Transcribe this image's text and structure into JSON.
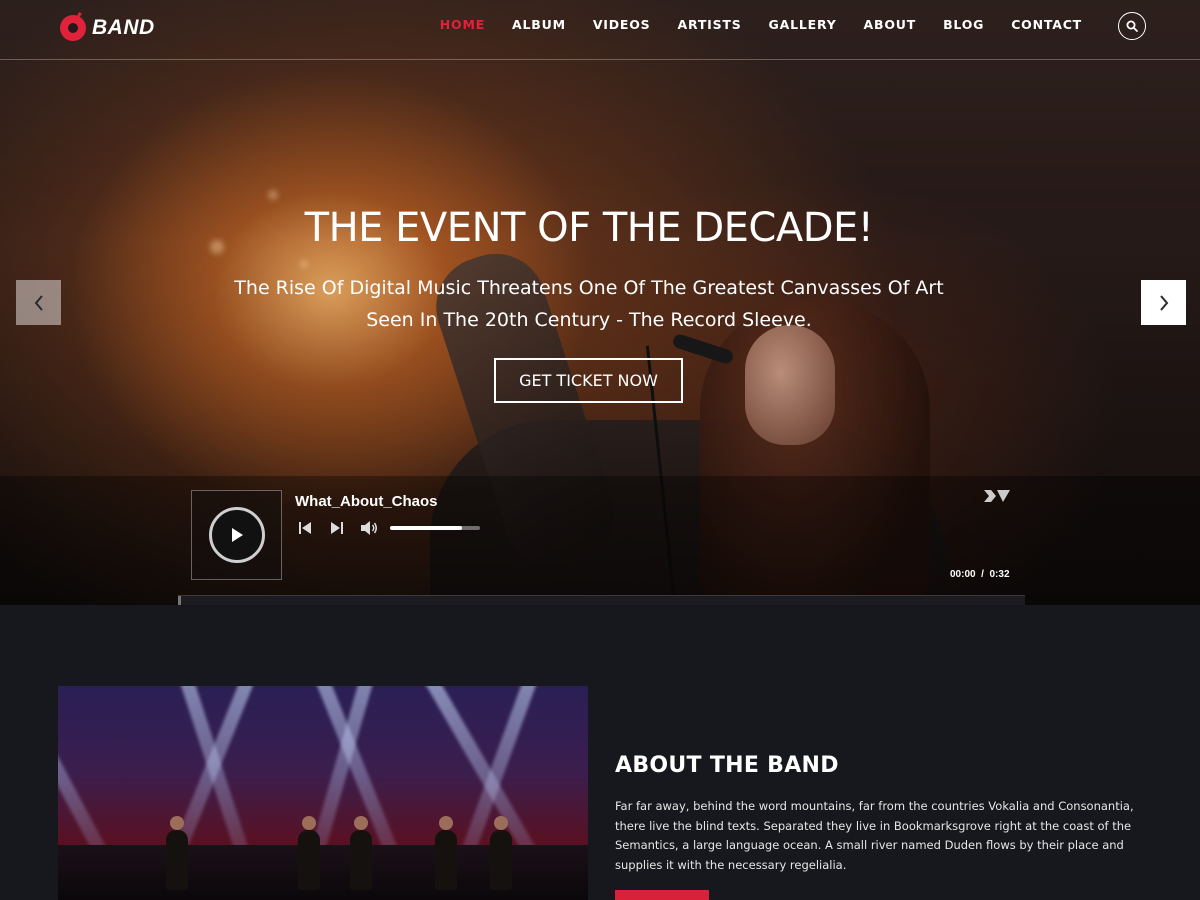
{
  "brand": {
    "name": "BAND",
    "accent": "#e0223b"
  },
  "nav": {
    "items": [
      "HOME",
      "ALBUM",
      "VIDEOS",
      "ARTISTS",
      "GALLERY",
      "ABOUT",
      "BLOG",
      "CONTACT"
    ],
    "active": "HOME",
    "search_icon": "search-icon"
  },
  "hero": {
    "title": "THE EVENT OF THE DECADE!",
    "subtitle_line1": "The Rise Of Digital Music Threatens One Of The Greatest Canvasses Of Art",
    "subtitle_line2": "Seen In The 20th Century - The Record Sleeve.",
    "cta_label": "GET TICKET NOW",
    "prev_icon": "chevron-left-icon",
    "next_icon": "chevron-right-icon"
  },
  "player": {
    "track": "What_About_Chaos",
    "current_time": "00:00",
    "separator": "/",
    "duration": "0:32",
    "volume": 0.8,
    "progress": 0.0
  },
  "about": {
    "title": "ABOUT THE BAND",
    "text": "Far far away, behind the word mountains, far from the countries Vokalia and Consonantia, there live the blind texts. Separated they live in Bookmarksgrove right at the coast of the Semantics, a large language ocean. A small river named Duden flows by their place and supplies it with the necessary regelialia."
  }
}
